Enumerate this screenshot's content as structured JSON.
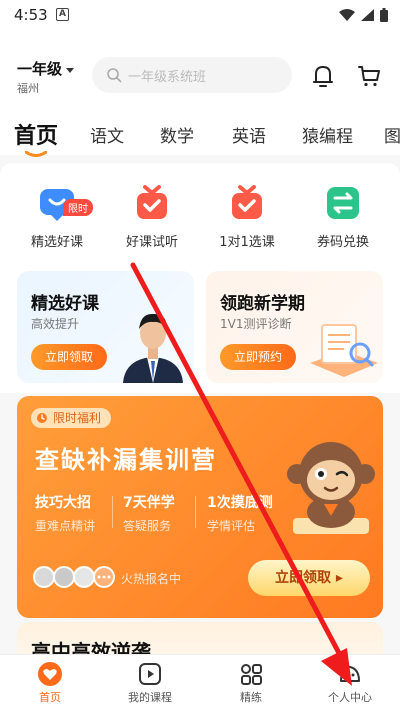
{
  "status": {
    "time": "4:53",
    "notif_letter": "A"
  },
  "header": {
    "grade": "一年级",
    "city": "福州",
    "search_placeholder": "一年级系统班"
  },
  "tabs": [
    "首页",
    "语文",
    "数学",
    "英语",
    "猿编程",
    "图"
  ],
  "quick": [
    {
      "label": "精选好课",
      "badge": "限时"
    },
    {
      "label": "好课试听"
    },
    {
      "label": "1对1选课"
    },
    {
      "label": "券码兑换"
    }
  ],
  "cards": [
    {
      "title": "精选好课",
      "subtitle": "高效提升",
      "button": "立即领取"
    },
    {
      "title": "领跑新学期",
      "subtitle": "1V1测评诊断",
      "button": "立即预约"
    }
  ],
  "banner": {
    "tag": "限时福利",
    "title": "查缺补漏集训营",
    "features": [
      {
        "title": "技巧大招",
        "sub": "重难点精讲"
      },
      {
        "title": "7天伴学",
        "sub": "答疑服务"
      },
      {
        "title": "1次摸底测",
        "sub": "学情评估"
      }
    ],
    "hot_text": "火热报名中",
    "button": "立即领取 ▸"
  },
  "next_card": {
    "title": "高中高效逆袭"
  },
  "bottom_nav": [
    {
      "label": "首页",
      "active": true
    },
    {
      "label": "我的课程"
    },
    {
      "label": "精练"
    },
    {
      "label": "个人中心"
    }
  ],
  "colors": {
    "accent": "#ff6a1a",
    "arrow": "#ee1c1c"
  }
}
